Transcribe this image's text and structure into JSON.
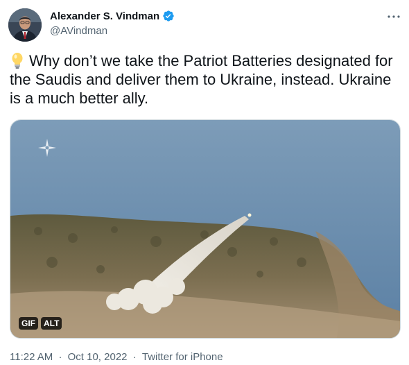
{
  "author": {
    "name": "Alexander S. Vindman",
    "handle": "@AVindman",
    "verified_color": "#1d9bf0"
  },
  "tweet": {
    "emoji": "light-bulb-icon",
    "text": "Why don’t we take the Patriot Batteries designated for the Saudis and deliver them to Ukraine, instead. Ukraine is a much better ally."
  },
  "media": {
    "type": "gif",
    "badge_gif": "GIF",
    "badge_alt": "ALT"
  },
  "meta": {
    "time": "11:22 AM",
    "date": "Oct 10, 2022",
    "source": "Twitter for iPhone",
    "separator": "·"
  },
  "colors": {
    "text_primary": "#0f1419",
    "text_secondary": "#536471",
    "accent": "#1d9bf0"
  }
}
